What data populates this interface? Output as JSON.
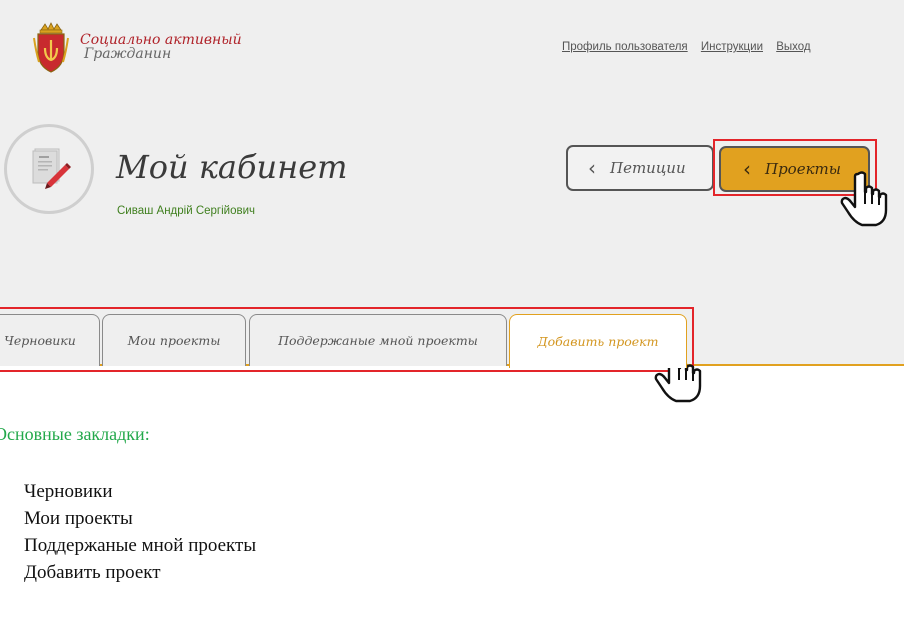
{
  "brand": {
    "line1": "Социально активный",
    "line2": "Гражданин",
    "colors": {
      "red": "#b0232a",
      "gold": "#e1a11f"
    }
  },
  "top_links": [
    {
      "label": "Профиль пользователя"
    },
    {
      "label": "Инструкции"
    },
    {
      "label": "Выход"
    }
  ],
  "cabinet": {
    "title": "Мой кабинет",
    "user_name": "Сиваш Андрій Сергійович",
    "avatar_icon": "document-pen-icon"
  },
  "nav_buttons": {
    "petitions": "Петиции",
    "projects": "Проекты",
    "chevron_icon": "chevron-left-icon"
  },
  "tabs": [
    {
      "label": "Черновики"
    },
    {
      "label": "Мои проекты"
    },
    {
      "label": "Поддержаные мной проекты"
    },
    {
      "label": "Добавить проект",
      "active": true
    }
  ],
  "content": {
    "heading": "Основные закладки:",
    "items": [
      "Черновики",
      "Мои проекты",
      "Поддержаные мной проекты",
      "Добавить проект"
    ]
  },
  "annotation_colors": {
    "highlight": "#e3252a"
  }
}
